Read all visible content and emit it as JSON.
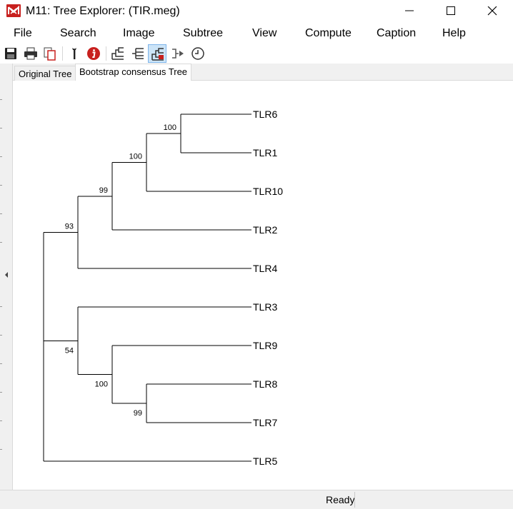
{
  "window": {
    "title": "M11: Tree Explorer: (TIR.meg)",
    "app_icon": "mega-logo-icon",
    "controls": [
      "minimize-icon",
      "maximize-icon",
      "close-icon"
    ]
  },
  "menu": {
    "items": [
      "File",
      "Search",
      "Image",
      "Subtree",
      "View",
      "Compute",
      "Caption",
      "Help"
    ]
  },
  "toolbar": {
    "buttons": [
      {
        "icon": "save-icon"
      },
      {
        "icon": "print-icon"
      },
      {
        "icon": "copy-icon"
      },
      {
        "icon": "wrench-icon"
      },
      {
        "icon": "info-icon"
      },
      {
        "icon": "rectangular-tree-icon"
      },
      {
        "icon": "straight-tree-icon"
      },
      {
        "icon": "topology-tree-icon",
        "active": true
      },
      {
        "icon": "subtree-arrow-icon"
      },
      {
        "icon": "clock-icon"
      }
    ]
  },
  "tabs": [
    {
      "label": "Original Tree",
      "active": false
    },
    {
      "label": "Bootstrap consensus Tree",
      "active": true
    }
  ],
  "tree": {
    "leaves": [
      {
        "name": "TLR6"
      },
      {
        "name": "TLR1"
      },
      {
        "name": "TLR10"
      },
      {
        "name": "TLR2"
      },
      {
        "name": "TLR4"
      },
      {
        "name": "TLR3"
      },
      {
        "name": "TLR9"
      },
      {
        "name": "TLR8"
      },
      {
        "name": "TLR7"
      },
      {
        "name": "TLR5"
      }
    ],
    "clades": [
      {
        "members": [
          "TLR6",
          "TLR1"
        ],
        "support": "100"
      },
      {
        "members": [
          "TLR6",
          "TLR1",
          "TLR10"
        ],
        "support": "100"
      },
      {
        "members": [
          "TLR6",
          "TLR1",
          "TLR10",
          "TLR2"
        ],
        "support": "99"
      },
      {
        "members": [
          "TLR6",
          "TLR1",
          "TLR10",
          "TLR2",
          "TLR4"
        ],
        "support": "93"
      },
      {
        "members": [
          "TLR8",
          "TLR7"
        ],
        "support": "99"
      },
      {
        "members": [
          "TLR9",
          "TLR8",
          "TLR7"
        ],
        "support": "100"
      },
      {
        "members": [
          "TLR3",
          "TLR9",
          "TLR8",
          "TLR7"
        ],
        "support": "54"
      }
    ]
  },
  "status": {
    "text": "Ready"
  },
  "colors": {
    "accent": "#c8201e",
    "toolbar_active": "#cce4f7",
    "branch": "#000000"
  }
}
